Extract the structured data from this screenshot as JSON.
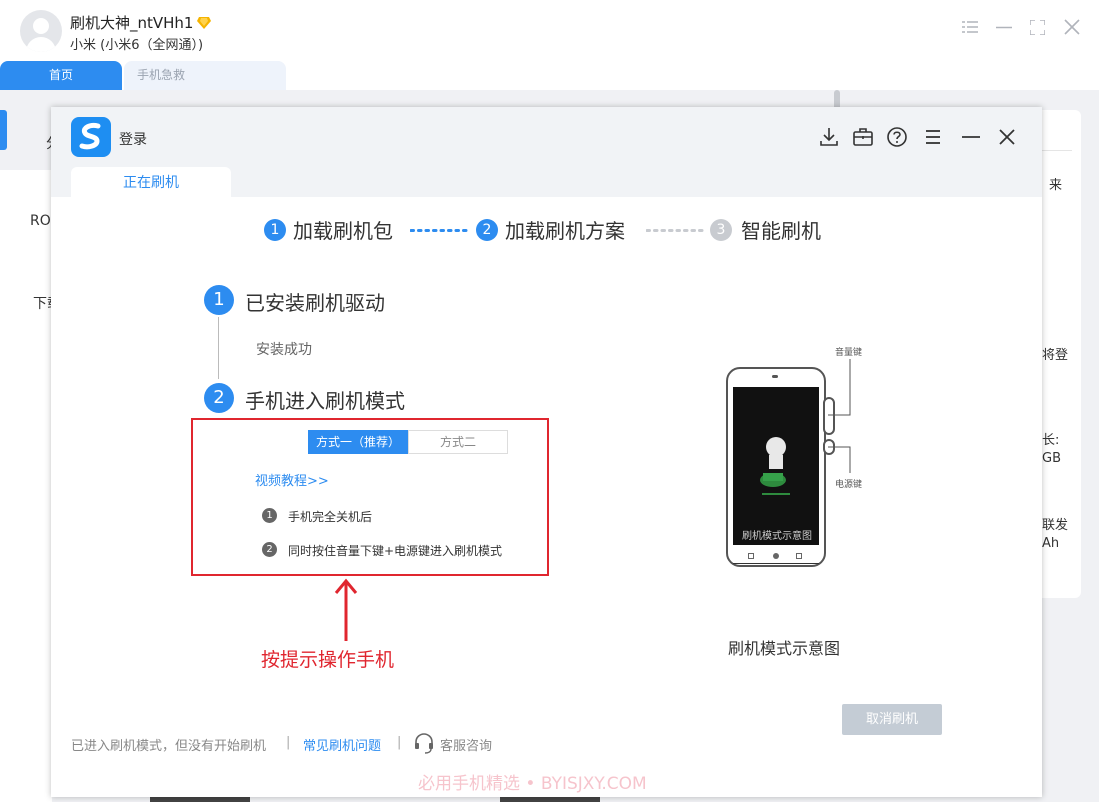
{
  "user": {
    "name": "刷机大神_ntVHh1",
    "device": "小米 (小米6（全网通）)"
  },
  "bg_tabs": {
    "home": "首页",
    "rescue": "手机急救"
  },
  "bg_left": {
    "item1": "RO",
    "item2": "下载",
    "item3": "分"
  },
  "bg_right": {
    "t1": "来",
    "t2": "将登",
    "t3": "长:",
    "t4": "GB",
    "t5": "联发",
    "t6": "Ah"
  },
  "dialog": {
    "title": "登录",
    "tab": "正在刷机",
    "steps": [
      {
        "num": "1",
        "label": "加载刷机包"
      },
      {
        "num": "2",
        "label": "加载刷机方案"
      },
      {
        "num": "3",
        "label": "智能刷机"
      }
    ],
    "stage1": {
      "num": "1",
      "title": "已安装刷机驱动",
      "status": "安装成功"
    },
    "stage2": {
      "num": "2",
      "title": "手机进入刷机模式"
    },
    "method_tabs": [
      "方式一（推荐）",
      "方式二"
    ],
    "video_link": "视频教程>>",
    "instructions": [
      {
        "num": "1",
        "text": "手机完全关机后"
      },
      {
        "num": "2",
        "text": "同时按住音量下键+电源键进入刷机模式"
      }
    ],
    "hint": "按提示操作手机",
    "phone": {
      "volume_label": "音量键",
      "power_label": "电源键",
      "screen_text": "刷机模式示意图",
      "caption": "刷机模式示意图"
    },
    "cancel_button": "取消刷机",
    "footer": {
      "text": "已进入刷机模式，但没有开始刷机",
      "sep": "|",
      "faq": "常见刷机问题",
      "support": "客服咨询"
    },
    "watermark": "必用手机精选 • BYISJXY.COM"
  },
  "colors": {
    "accent": "#2d8cf0",
    "alert": "#e0262f",
    "disabled_step": "#c8cbd0",
    "cancel_bg": "#c4ccd5"
  },
  "icons": [
    "download-icon",
    "toolbox-icon",
    "help-icon",
    "menu-icon",
    "minimize-icon",
    "close-icon",
    "headset-icon",
    "up-arrow-icon"
  ]
}
